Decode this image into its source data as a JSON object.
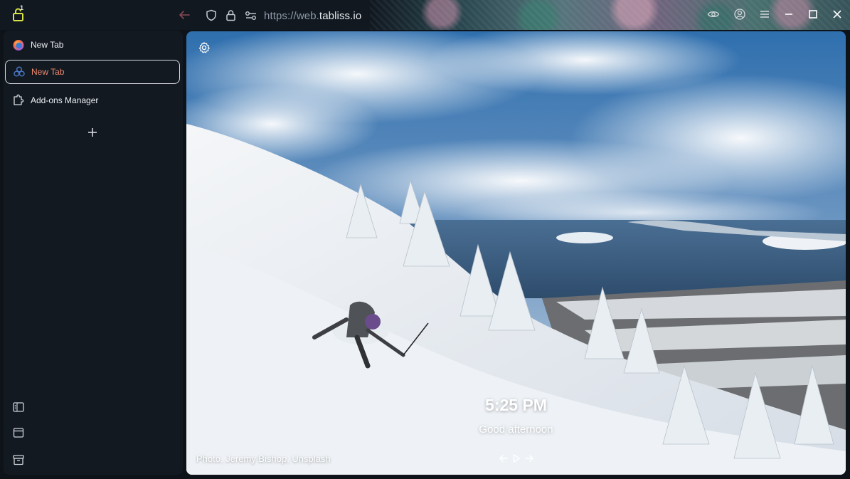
{
  "toolbar": {
    "extension_badge": "1",
    "url_scheme": "https://web.",
    "url_domain": "tabliss.io"
  },
  "sidebar": {
    "tabs": [
      {
        "label": "New Tab",
        "icon": "firefox-icon",
        "active": false
      },
      {
        "label": "New Tab",
        "icon": "tabliss-icon",
        "active": true
      },
      {
        "label": "Add-ons Manager",
        "icon": "puzzle-icon",
        "active": false
      }
    ],
    "new_tab_icon": "plus-icon",
    "bottom_icons": [
      "sidebar-toggle-icon",
      "window-icon",
      "archive-icon"
    ]
  },
  "newtab": {
    "time": "5:25 PM",
    "greeting": "Good afternoon",
    "credit": "Photo, Jeremy Bishop, Unsplash"
  },
  "colors": {
    "active_tab_text": "#f08a70",
    "background": "#0e131a"
  }
}
